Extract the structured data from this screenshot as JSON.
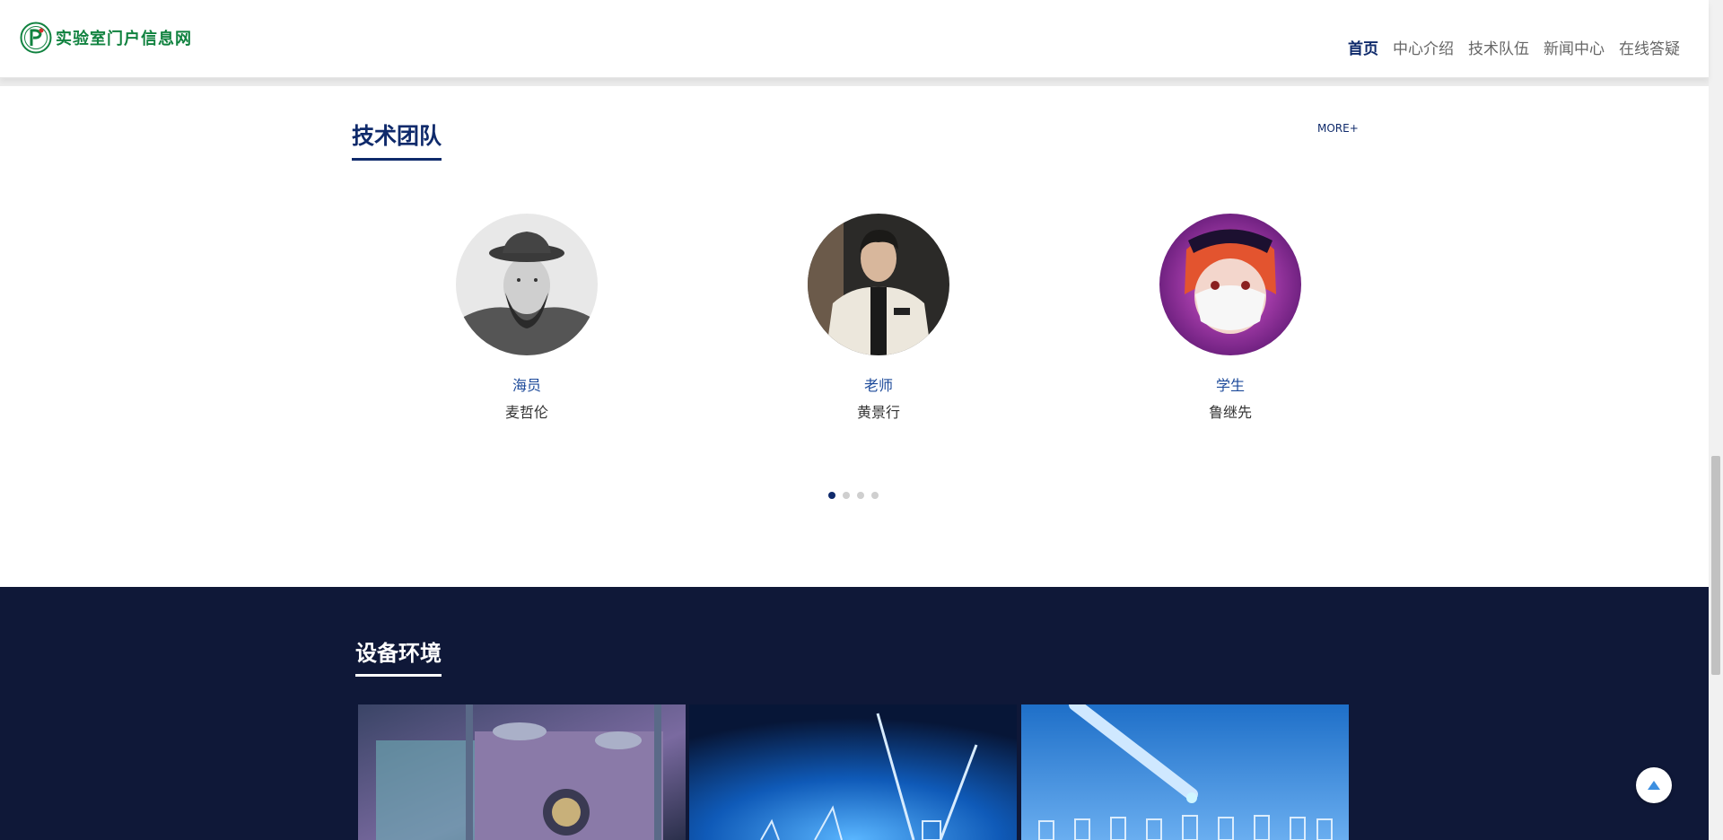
{
  "header": {
    "logo_text": "实验室门户信息网",
    "nav": [
      {
        "label": "首页",
        "active": true
      },
      {
        "label": "中心介绍",
        "active": false
      },
      {
        "label": "技术队伍",
        "active": false
      },
      {
        "label": "新闻中心",
        "active": false
      },
      {
        "label": "在线答疑",
        "active": false
      }
    ]
  },
  "team": {
    "title": "技术团队",
    "more": "MORE+",
    "members": [
      {
        "role": "海员",
        "name": "麦哲伦"
      },
      {
        "role": "老师",
        "name": "黄景行"
      },
      {
        "role": "学生",
        "name": "鲁继先"
      }
    ],
    "pagination": {
      "total": 4,
      "current": 1
    }
  },
  "equipment": {
    "title": "设备环境"
  },
  "colors": {
    "brand_green": "#10823f",
    "primary_navy": "#0f2a6b",
    "footer_bg": "#0f1838"
  },
  "icons": {
    "back_to_top": "triangle-up-icon"
  }
}
